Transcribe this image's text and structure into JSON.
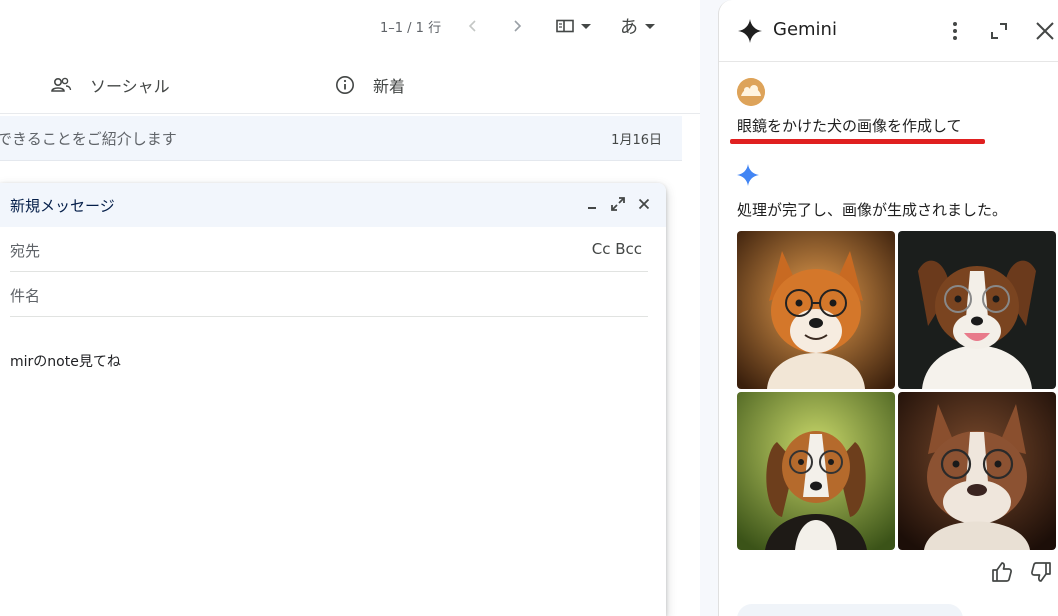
{
  "gmail": {
    "pager": "1–1 / 1 行",
    "lang_button": "あ",
    "tabs": [
      {
        "label": "ソーシャル",
        "icon": "people-icon"
      },
      {
        "label": "新着",
        "icon": "info-icon"
      }
    ],
    "mail_row": {
      "snippet": "できることをご紹介します",
      "date": "1月16日"
    }
  },
  "compose": {
    "title": "新規メッセージ",
    "to_label": "宛先",
    "cc_bcc": "Cc Bcc",
    "subject_placeholder": "件名",
    "body": "mirのnote見てね"
  },
  "gemini": {
    "title": "Gemini",
    "prompt": "眼鏡をかけた犬の画像を作成して",
    "response": "処理が完了し、画像が生成されました。",
    "images": [
      "shiba-inu-with-glasses",
      "border-collie-with-glasses",
      "beagle-with-glasses",
      "bulldog-with-glasses"
    ],
    "accent_red": "#e02020",
    "spark_color": "#4285f4"
  }
}
